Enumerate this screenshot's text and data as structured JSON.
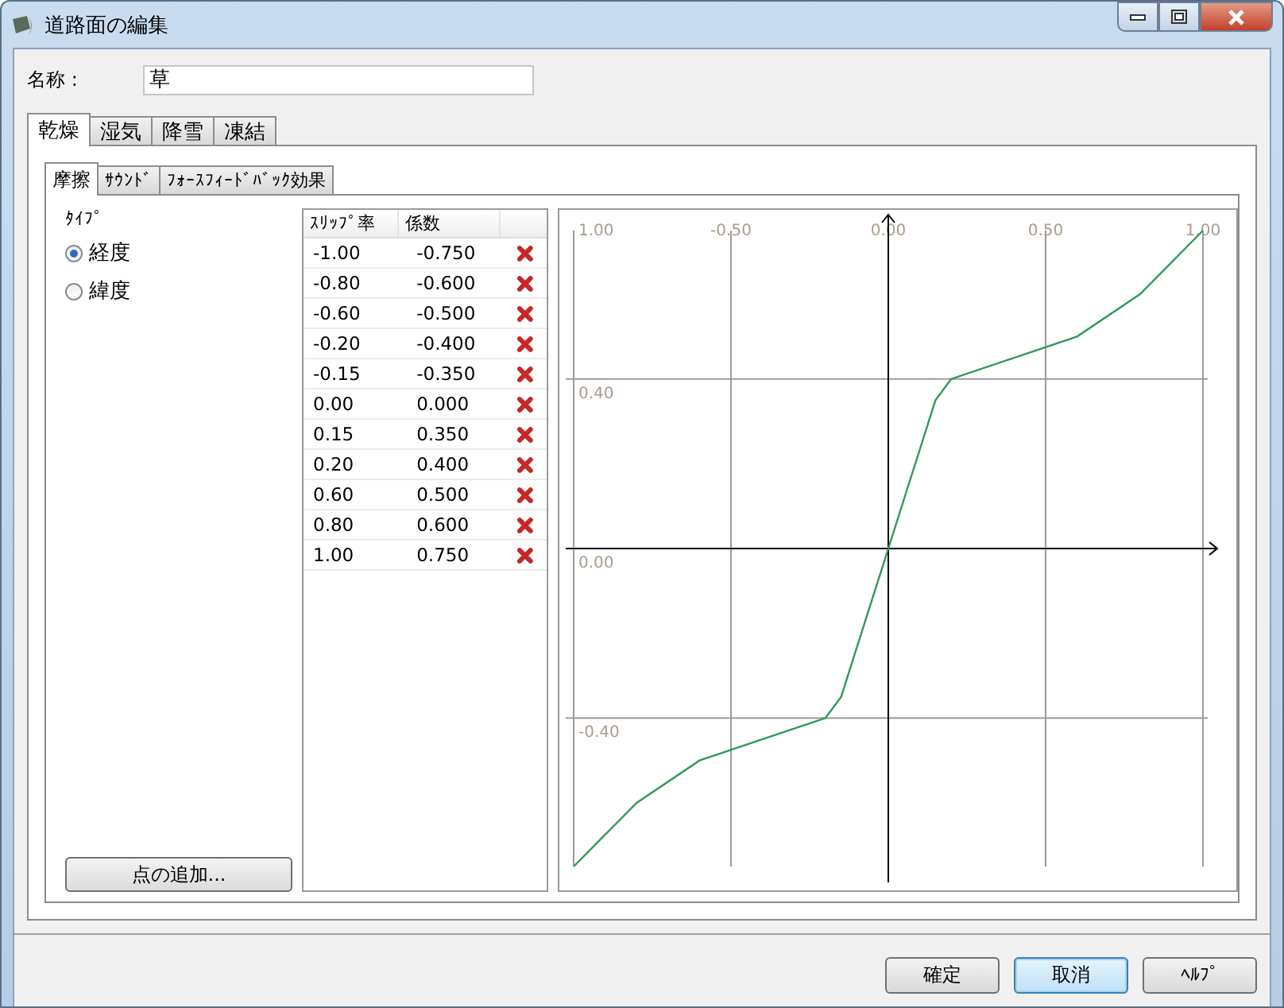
{
  "window": {
    "title": "道路面の編集"
  },
  "name_field": {
    "label": "名称 :",
    "value": "草"
  },
  "surface_tabs": [
    {
      "label": "乾燥",
      "selected": true
    },
    {
      "label": "湿気",
      "selected": false
    },
    {
      "label": "降雪",
      "selected": false
    },
    {
      "label": "凍結",
      "selected": false
    }
  ],
  "sub_tabs": [
    {
      "label": "摩擦",
      "selected": true
    },
    {
      "label": "ｻｳﾝﾄﾞ",
      "selected": false
    },
    {
      "label": "ﾌｫｰｽﾌｨｰﾄﾞﾊﾞｯｸ効果",
      "selected": false
    }
  ],
  "type_group": {
    "label": "ﾀｲﾌﾟ",
    "options": [
      {
        "label": "経度",
        "selected": true
      },
      {
        "label": "緯度",
        "selected": false
      }
    ]
  },
  "add_point_button": "点の追加...",
  "table": {
    "columns": [
      "ｽﾘｯﾌﾟ率",
      "係数"
    ],
    "rows": [
      {
        "slip": "-1.00",
        "coefficient": "-0.750"
      },
      {
        "slip": "-0.80",
        "coefficient": "-0.600"
      },
      {
        "slip": "-0.60",
        "coefficient": "-0.500"
      },
      {
        "slip": "-0.20",
        "coefficient": "-0.400"
      },
      {
        "slip": "-0.15",
        "coefficient": "-0.350"
      },
      {
        "slip": "0.00",
        "coefficient": "0.000"
      },
      {
        "slip": "0.15",
        "coefficient": "0.350"
      },
      {
        "slip": "0.20",
        "coefficient": "0.400"
      },
      {
        "slip": "0.60",
        "coefficient": "0.500"
      },
      {
        "slip": "0.80",
        "coefficient": "0.600"
      },
      {
        "slip": "1.00",
        "coefficient": "0.750"
      }
    ]
  },
  "chart": {
    "chart_data": {
      "type": "line",
      "x": [
        -1,
        -0.8,
        -0.6,
        -0.2,
        -0.15,
        0,
        0.15,
        0.2,
        0.6,
        0.8,
        1
      ],
      "series": [
        {
          "color": "#2e9a5a",
          "values": [
            -0.75,
            -0.6,
            -0.5,
            -0.4,
            -0.35,
            0,
            0.35,
            0.4,
            0.5,
            0.6,
            0.75
          ]
        }
      ],
      "grid": true,
      "xlim": [
        -1,
        1
      ],
      "ylim": [
        -0.75,
        0.75
      ],
      "xticks": [
        {
          "value": -1,
          "label": "1.00"
        },
        {
          "value": -0.5,
          "label": "-0.50"
        },
        {
          "value": 0,
          "label": "0.00"
        },
        {
          "value": 0.5,
          "label": "0.50"
        },
        {
          "value": 1,
          "label": "1.00"
        }
      ],
      "yticks": [
        {
          "value": 0.4,
          "label": "0.40"
        },
        {
          "value": 0,
          "label": "0.00"
        },
        {
          "value": -0.4,
          "label": "-0.40"
        }
      ]
    }
  },
  "buttons": [
    {
      "label": "確定",
      "default": false
    },
    {
      "label": "取消",
      "default": true
    },
    {
      "label": "ﾍﾙﾌﾟ",
      "default": false
    }
  ]
}
